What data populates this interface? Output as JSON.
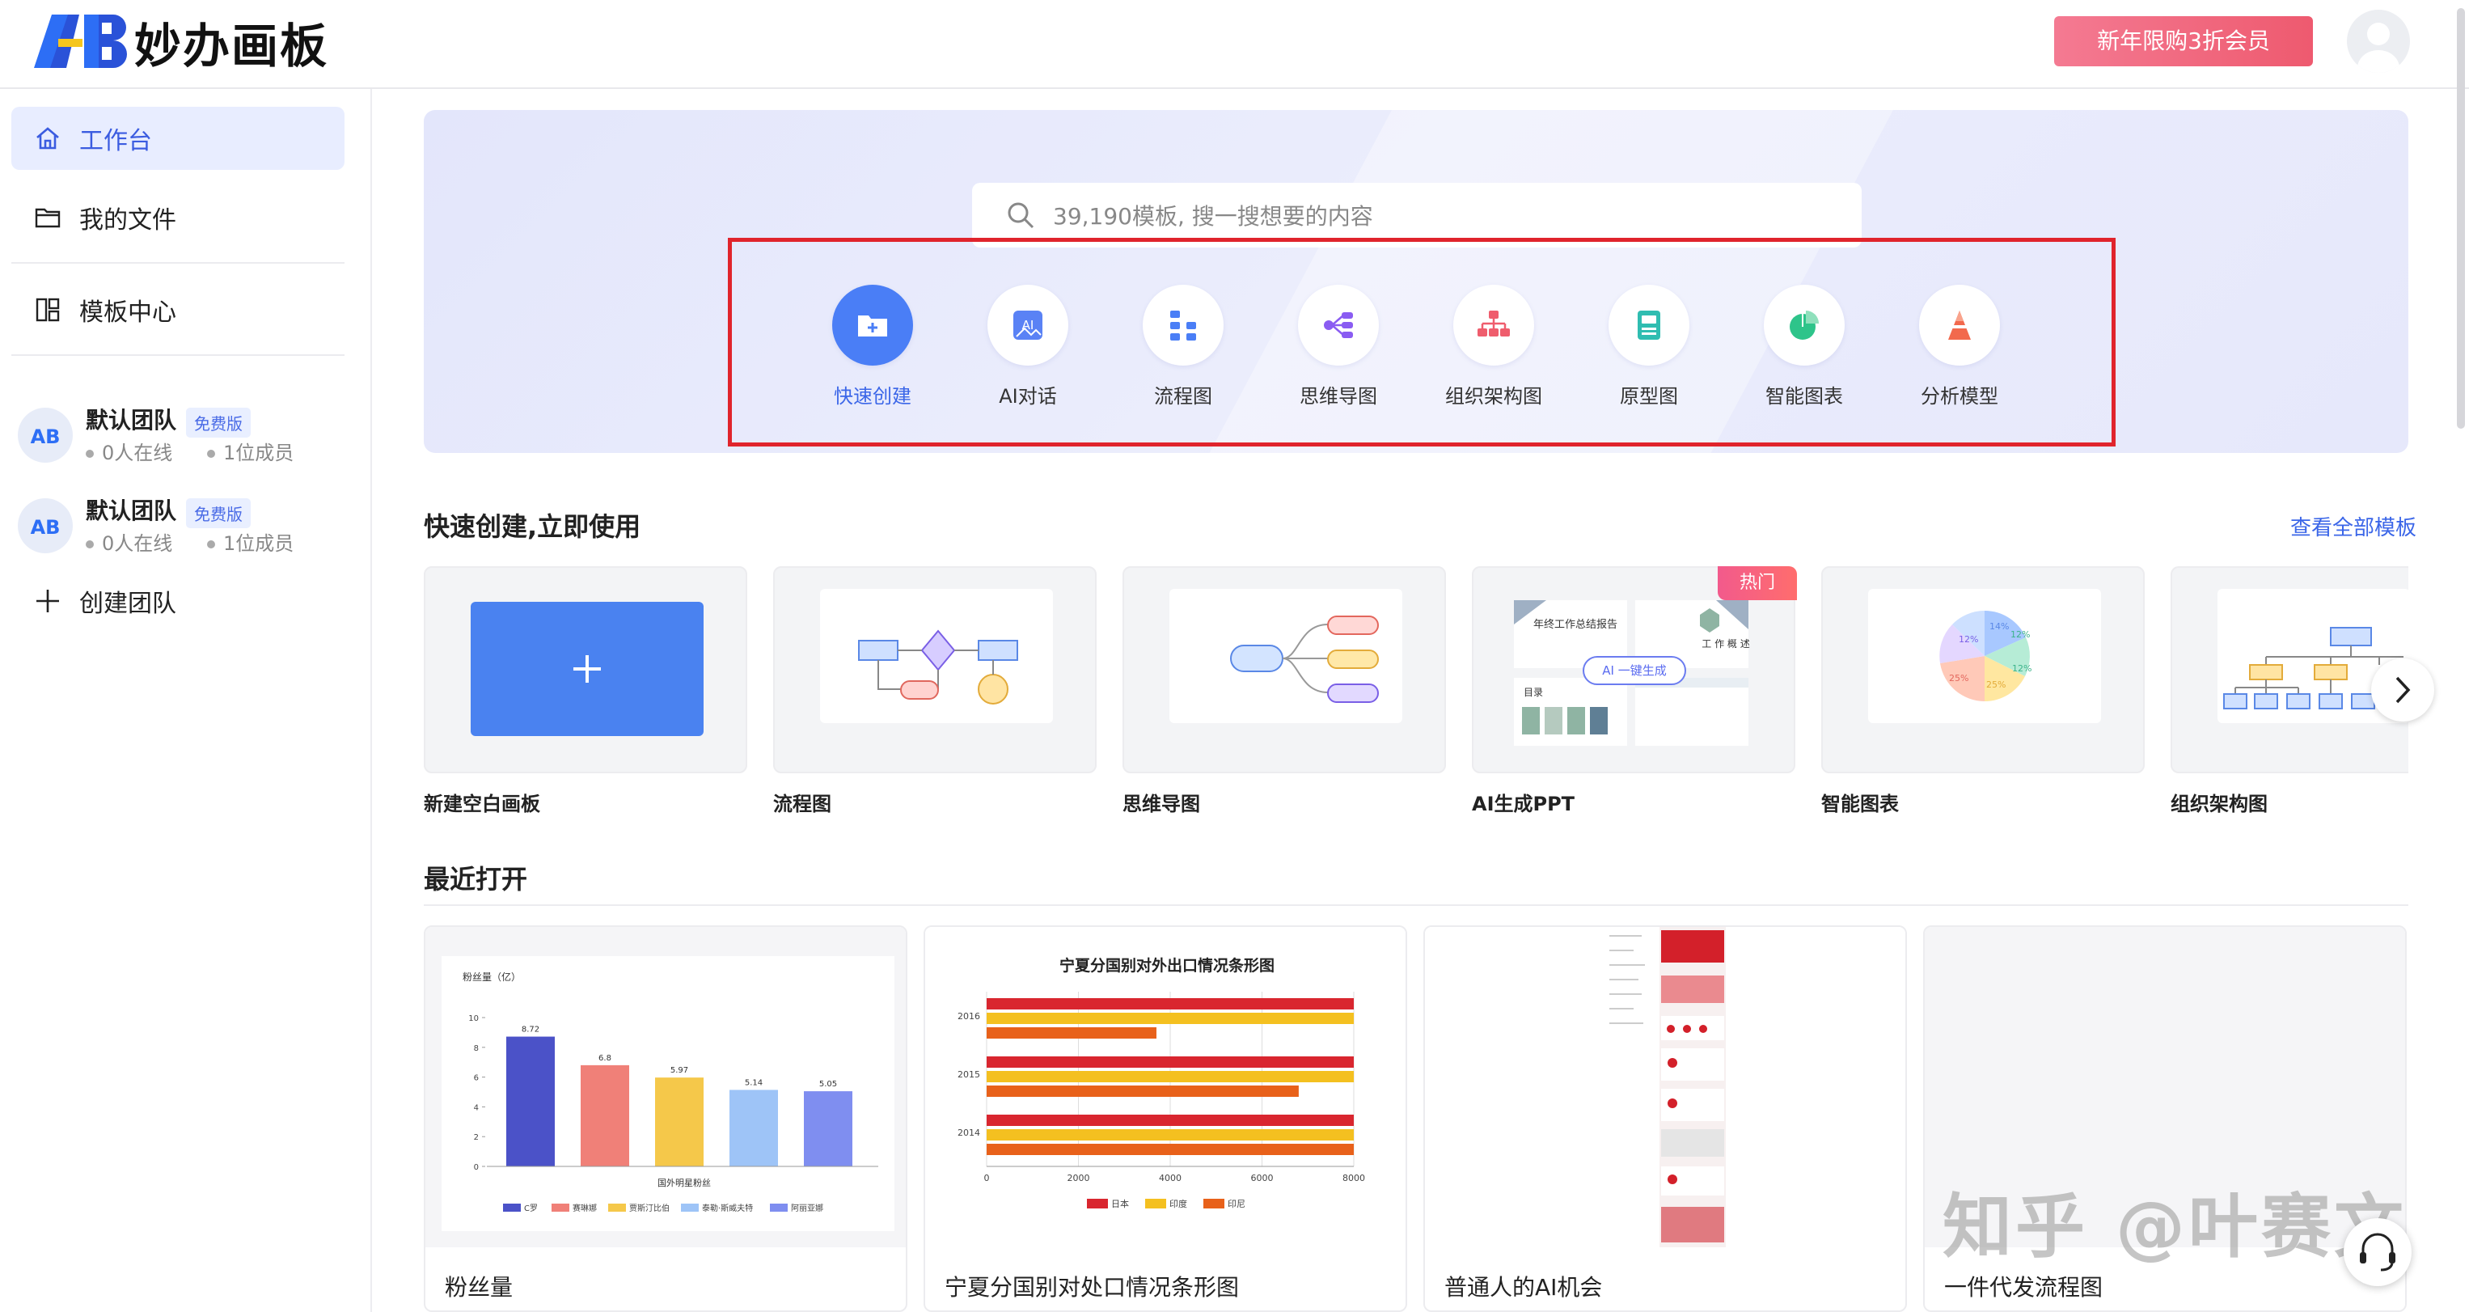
{
  "header": {
    "app_title": "妙办画板",
    "promo_label": "新年限购3折会员"
  },
  "sidebar": {
    "nav": [
      {
        "label": "工作台",
        "icon": "home-icon",
        "active": true
      },
      {
        "label": "我的文件",
        "icon": "folder-icon"
      },
      {
        "label": "模板中心",
        "icon": "template-icon"
      }
    ],
    "teams": [
      {
        "name": "默认团队",
        "badge": "免费版",
        "online": "0人在线",
        "members": "1位成员"
      },
      {
        "name": "默认团队",
        "badge": "免费版",
        "online": "0人在线",
        "members": "1位成员"
      }
    ],
    "create_team": "创建团队"
  },
  "search": {
    "placeholder": "39,190模板, 搜一搜想要的内容"
  },
  "tools": [
    {
      "label": "快速创建",
      "icon": "folder-plus-icon",
      "active": true
    },
    {
      "label": "AI对话",
      "icon": "ai-icon"
    },
    {
      "label": "流程图",
      "icon": "flowchart-icon"
    },
    {
      "label": "思维导图",
      "icon": "mindmap-icon"
    },
    {
      "label": "组织架构图",
      "icon": "org-chart-icon"
    },
    {
      "label": "原型图",
      "icon": "prototype-icon"
    },
    {
      "label": "智能图表",
      "icon": "pie-chart-icon"
    },
    {
      "label": "分析模型",
      "icon": "pyramid-icon"
    }
  ],
  "quick_create": {
    "title": "快速创建,立即使用",
    "view_all": "查看全部模板",
    "hot_badge": "热门",
    "templates": [
      {
        "name": "新建空白画板"
      },
      {
        "name": "流程图"
      },
      {
        "name": "思维导图"
      },
      {
        "name": "AI生成PPT",
        "ppt_title": "年终工作总结报告",
        "ppt_overview": "工 作 概 述",
        "ppt_contents": "目录",
        "ai_chip": "AI 一键生成"
      },
      {
        "name": "智能图表",
        "pie_labels": [
          "14%",
          "12%",
          "12%",
          "25%",
          "25%",
          "12%"
        ]
      },
      {
        "name": "组织架构图"
      }
    ]
  },
  "recent": {
    "title": "最近打开",
    "items": [
      {
        "name": "粉丝量",
        "chart": {
          "ylabel": "粉丝量（亿）",
          "xlabel": "国外明星粉丝",
          "yticks": [
            "10",
            "8",
            "6",
            "4",
            "2",
            "0"
          ],
          "values": [
            "8.72",
            "6.8",
            "5.97",
            "5.14",
            "5.05"
          ],
          "legend": [
            "C罗",
            "赛琳娜",
            "贾斯汀比伯",
            "泰勒·斯威夫特",
            "阿丽亚娜"
          ]
        }
      },
      {
        "name": "宁夏分国别对处口情况条形图",
        "chart": {
          "title": "宁夏分国别对外出口情况条形图",
          "years": [
            "2016",
            "2015",
            "2014"
          ],
          "xticks": [
            "0",
            "2000",
            "4000",
            "6000",
            "8000"
          ],
          "legend": [
            "日本",
            "印度",
            "印尼"
          ]
        }
      },
      {
        "name": "普通人的AI机会"
      },
      {
        "name": "一件代发流程图"
      }
    ]
  },
  "watermark": "知乎 @叶赛文",
  "colors": {
    "accent": "#3b66e8",
    "promo": "#ef5f76",
    "highlight_box": "#e0242c"
  }
}
